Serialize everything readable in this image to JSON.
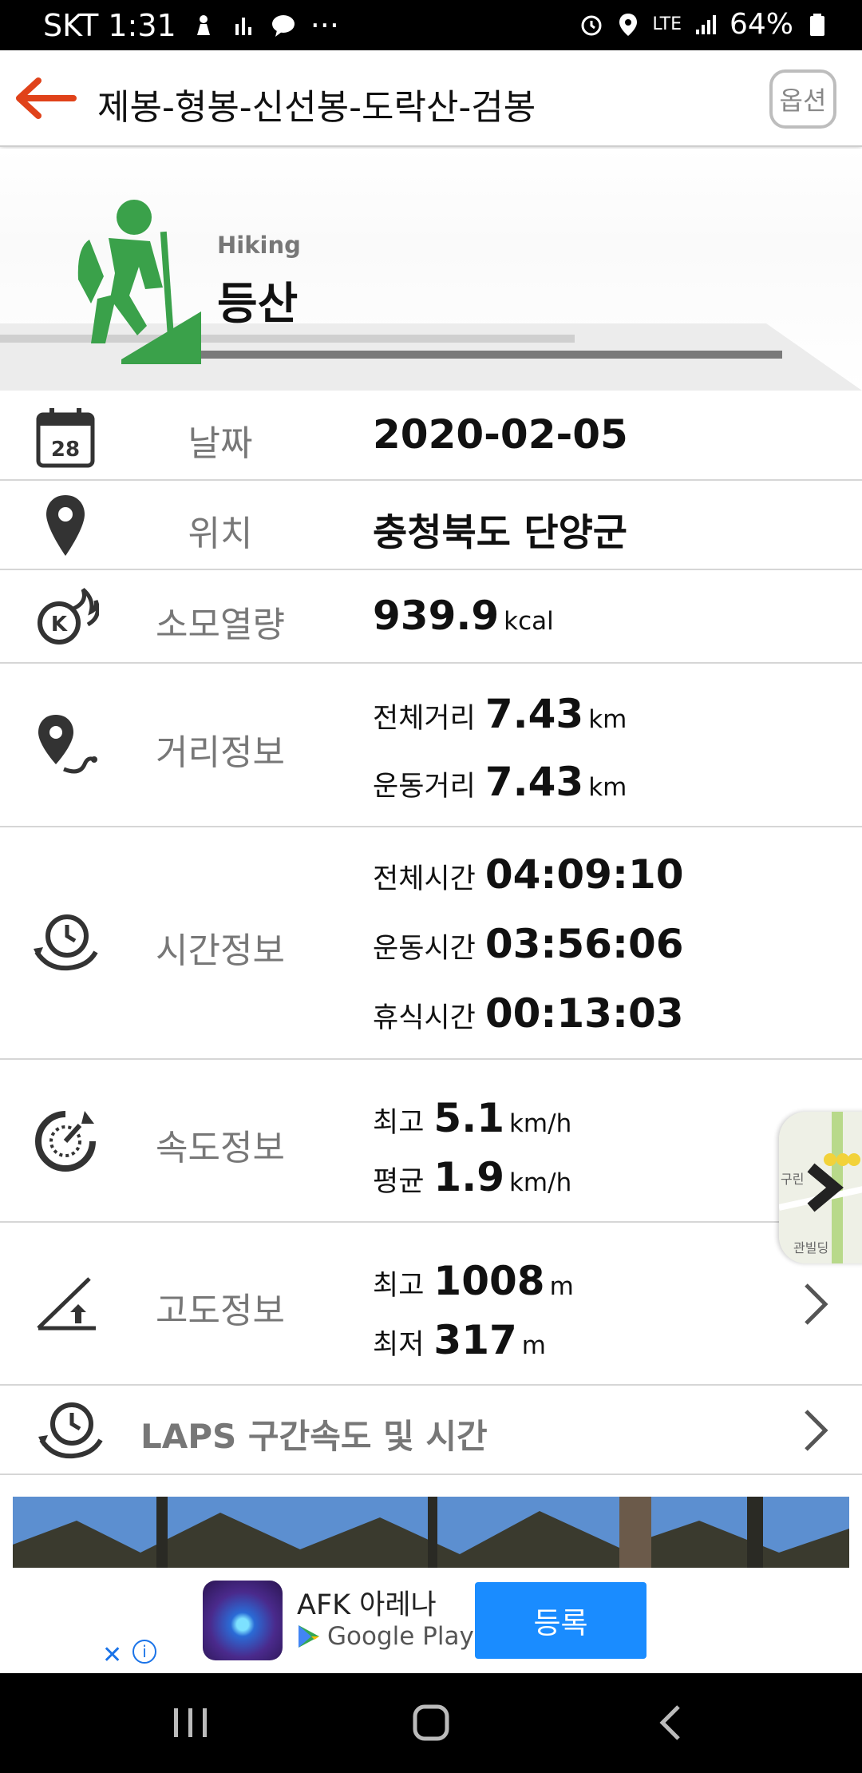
{
  "status_bar": {
    "carrier_time": "SKT 1:31",
    "dots": "···",
    "network": "LTE",
    "battery": "64%"
  },
  "header": {
    "title": "제봉-형봉-신선봉-도락산-검봉",
    "option_label": "옵션"
  },
  "activity": {
    "type_en": "Hiking",
    "type_ko": "등산",
    "accent_color": "#3aa14a"
  },
  "rows": {
    "date": {
      "icon_number": "28",
      "label": "날짜",
      "value": "2020-02-05"
    },
    "location": {
      "label": "위치",
      "value": "충청북도 단양군"
    },
    "calories": {
      "label": "소모열량",
      "value": "939.9",
      "unit": "kcal"
    },
    "distance": {
      "label": "거리정보",
      "total_label": "전체거리",
      "total_value": "7.43",
      "total_unit": "km",
      "exercise_label": "운동거리",
      "exercise_value": "7.43",
      "exercise_unit": "km"
    },
    "time": {
      "label": "시간정보",
      "total_label": "전체시간",
      "total_value": "04:09:10",
      "exercise_label": "운동시간",
      "exercise_value": "03:56:06",
      "rest_label": "휴식시간",
      "rest_value": "00:13:03"
    },
    "speed": {
      "label": "속도정보",
      "max_label": "최고",
      "max_value": "5.1",
      "max_unit": "km/h",
      "avg_label": "평균",
      "avg_value": "1.9",
      "avg_unit": "km/h"
    },
    "altitude": {
      "label": "고도정보",
      "max_label": "최고",
      "max_value": "1008",
      "max_unit": "m",
      "min_label": "최저",
      "min_value": "317",
      "min_unit": "m"
    },
    "laps": {
      "label": "LAPS 구간속도 및 시간"
    }
  },
  "map_thumb": {
    "text1": "구린",
    "text2": "관빌딩"
  },
  "ad": {
    "app_name": "AFK 아레나",
    "store": "Google Play",
    "cta": "등록",
    "close": "✕",
    "info": "i"
  }
}
